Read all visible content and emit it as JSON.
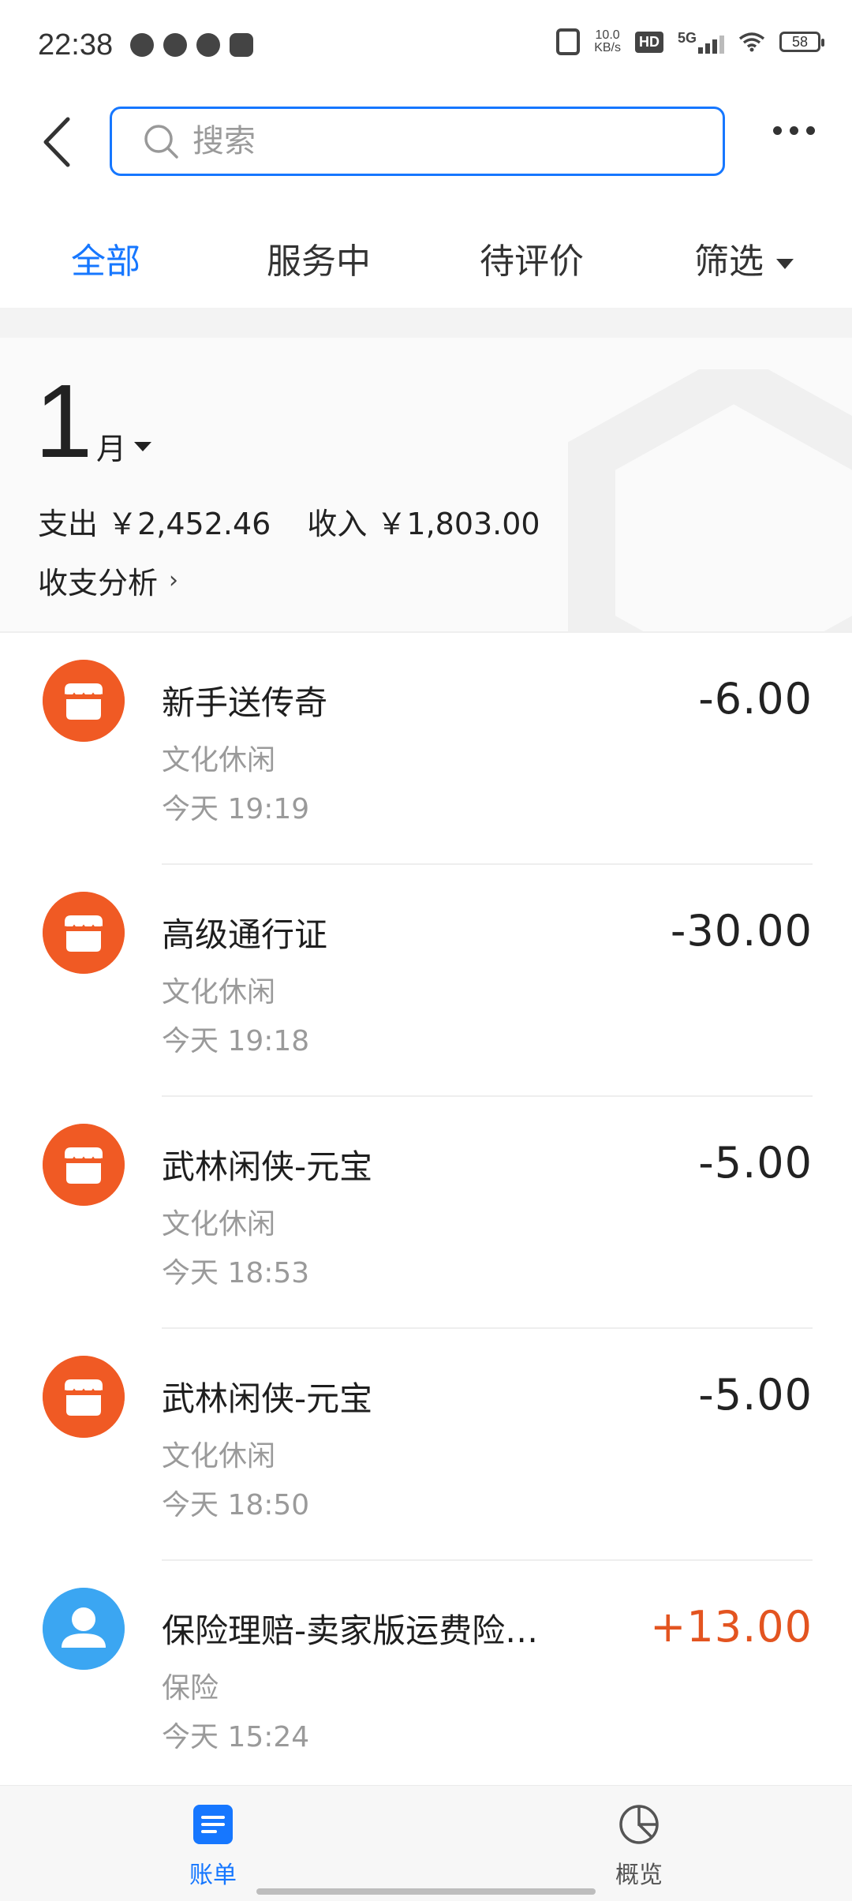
{
  "status_bar": {
    "time": "22:38",
    "network_speed_value": "10.0",
    "network_speed_unit": "KB/s",
    "hd_label": "HD",
    "network_type": "5G",
    "battery": "58"
  },
  "header": {
    "search_placeholder": "搜索"
  },
  "tabs": [
    {
      "label": "全部",
      "active": true
    },
    {
      "label": "服务中",
      "active": false
    },
    {
      "label": "待评价",
      "active": false
    },
    {
      "label": "筛选",
      "active": false
    }
  ],
  "summary": {
    "month_number": "1",
    "month_unit": "月",
    "expense_text": "支出 ￥2,452.46",
    "income_text": "收入 ￥1,803.00",
    "analysis_label": "收支分析",
    "analysis_chevron": "›"
  },
  "transactions": [
    {
      "title": "新手送传奇",
      "category": "文化休闲",
      "time": "今天  19:19",
      "amount": "-6.00",
      "icon": "shop-icon"
    },
    {
      "title": "高级通行证",
      "category": "文化休闲",
      "time": "今天  19:18",
      "amount": "-30.00",
      "icon": "shop-icon"
    },
    {
      "title": "武林闲侠-元宝",
      "category": "文化休闲",
      "time": "今天  18:53",
      "amount": "-5.00",
      "icon": "shop-icon"
    },
    {
      "title": "武林闲侠-元宝",
      "category": "文化休闲",
      "time": "今天  18:50",
      "amount": "-5.00",
      "icon": "shop-icon"
    },
    {
      "title": "保险理赔-卖家版运费险…",
      "category": "保险",
      "time": "今天  15:24",
      "amount": "+13.00",
      "icon": "user-icon"
    }
  ],
  "bottom_nav": [
    {
      "label": "账单",
      "active": true
    },
    {
      "label": "概览",
      "active": false
    }
  ],
  "colors": {
    "accent": "#1677ff",
    "shop_icon_bg": "#f05a24",
    "user_icon_bg": "#3ba6f2",
    "income_text": "#e35420"
  }
}
